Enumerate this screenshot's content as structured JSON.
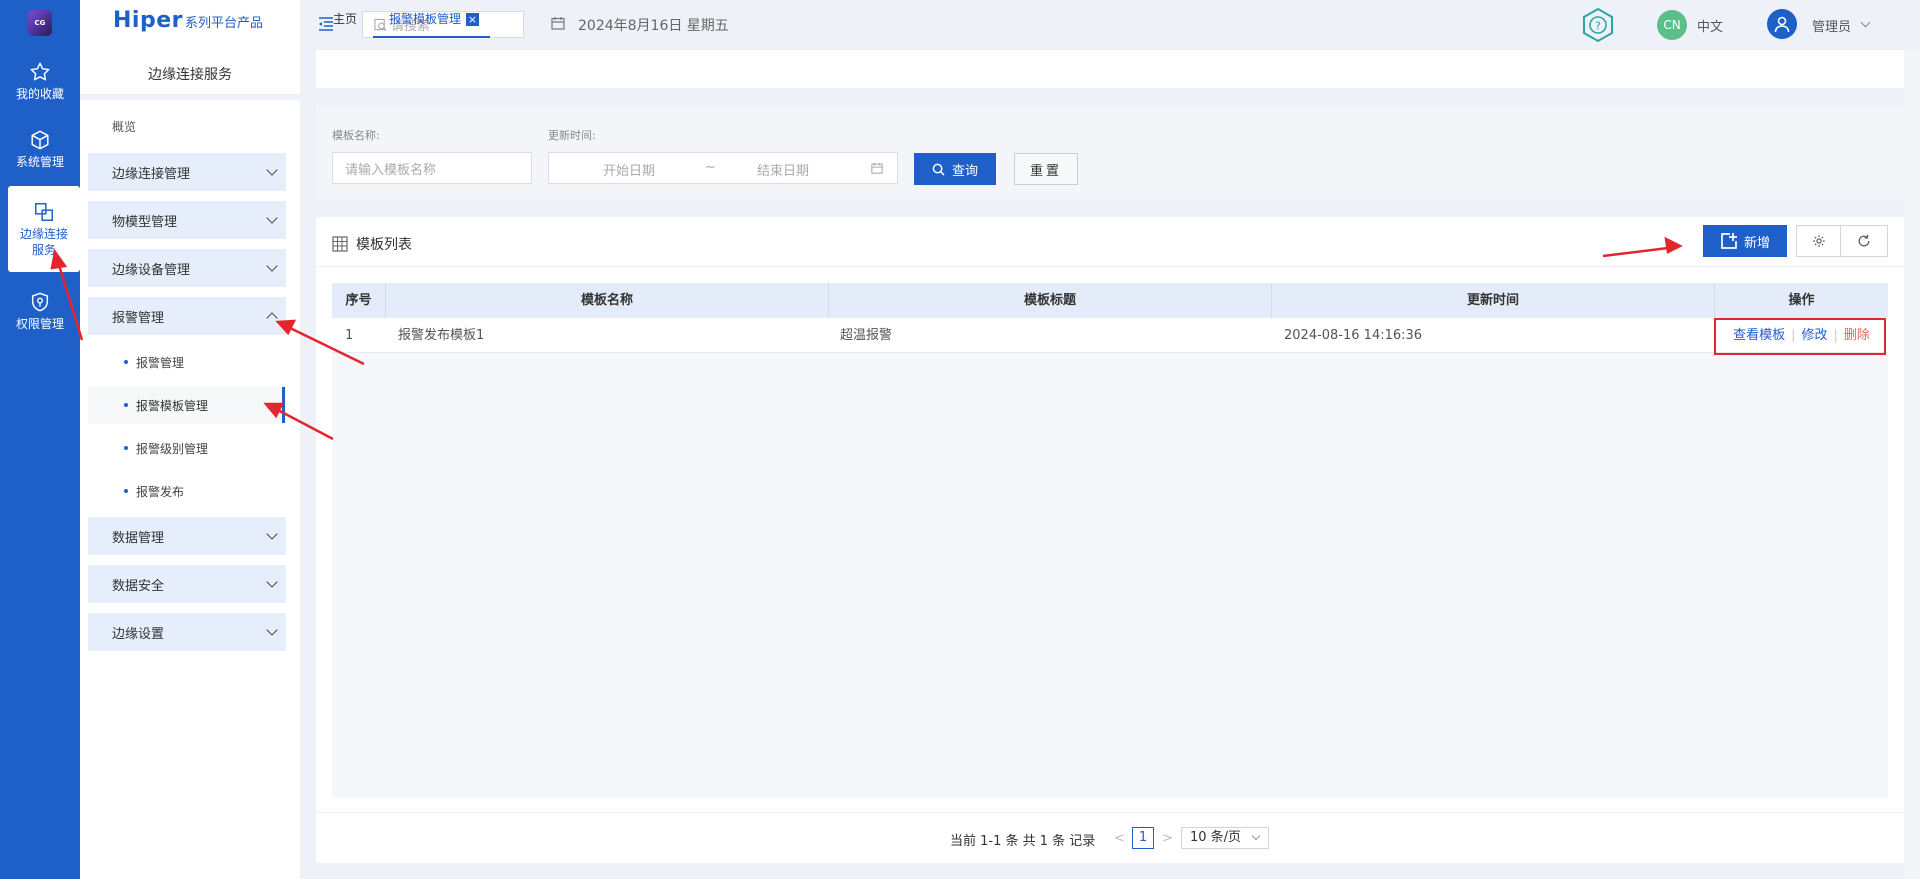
{
  "rail": {
    "logo_text": "CG",
    "items": [
      {
        "label": "我的收藏",
        "icon": "star-icon"
      },
      {
        "label": "系统管理",
        "icon": "cube-icon"
      },
      {
        "label": "边缘连接\n服务",
        "icon": "copy-squares-icon",
        "active": true
      },
      {
        "label": "权限管理",
        "icon": "shield-icon"
      }
    ]
  },
  "brand": {
    "main": "Hiper",
    "sub": "系列平台产品"
  },
  "sidebar": {
    "title": "边缘连接服务",
    "overview": "概览",
    "groups": [
      {
        "label": "边缘连接管理"
      },
      {
        "label": "物模型管理"
      },
      {
        "label": "边缘设备管理"
      },
      {
        "label": "报警管理",
        "expanded": true
      },
      {
        "label": "数据管理"
      },
      {
        "label": "数据安全"
      },
      {
        "label": "边缘设置"
      }
    ],
    "alarm_subitems": [
      {
        "label": "报警管理"
      },
      {
        "label": "报警模板管理",
        "active": true
      },
      {
        "label": "报警级别管理"
      },
      {
        "label": "报警发布"
      }
    ]
  },
  "topbar": {
    "search_placeholder": "请搜索",
    "date": "2024年8月16日 星期五",
    "lang_badge": "CN",
    "lang": "中文",
    "user": "管理员"
  },
  "tabs": [
    {
      "label": "主页"
    },
    {
      "label": "报警模板管理",
      "active": true,
      "close": "×"
    }
  ],
  "filter": {
    "name_label": "模板名称:",
    "name_placeholder": "请输入模板名称",
    "time_label": "更新时间:",
    "start_placeholder": "开始日期",
    "range_sep": "~",
    "end_placeholder": "结束日期",
    "query": "查询",
    "reset": "重置"
  },
  "list": {
    "title": "模板列表",
    "add": "新增",
    "columns": [
      "序号",
      "模板名称",
      "模板标题",
      "更新时间",
      "操作"
    ],
    "rows": [
      {
        "index": "1",
        "name": "报警发布模板1",
        "title": "超温报警",
        "updated": "2024-08-16 14:16:36"
      }
    ],
    "ops": {
      "view": "查看模板",
      "edit": "修改",
      "delete": "删除",
      "sep": "|"
    }
  },
  "pager": {
    "summary": "当前 1-1 条 共 1 条 记录",
    "prev": "<",
    "current": "1",
    "next": ">",
    "page_size": "10 条/页"
  },
  "colors": {
    "accent": "#1f5fc8",
    "danger": "#e06464",
    "annotation": "#e3262e"
  }
}
